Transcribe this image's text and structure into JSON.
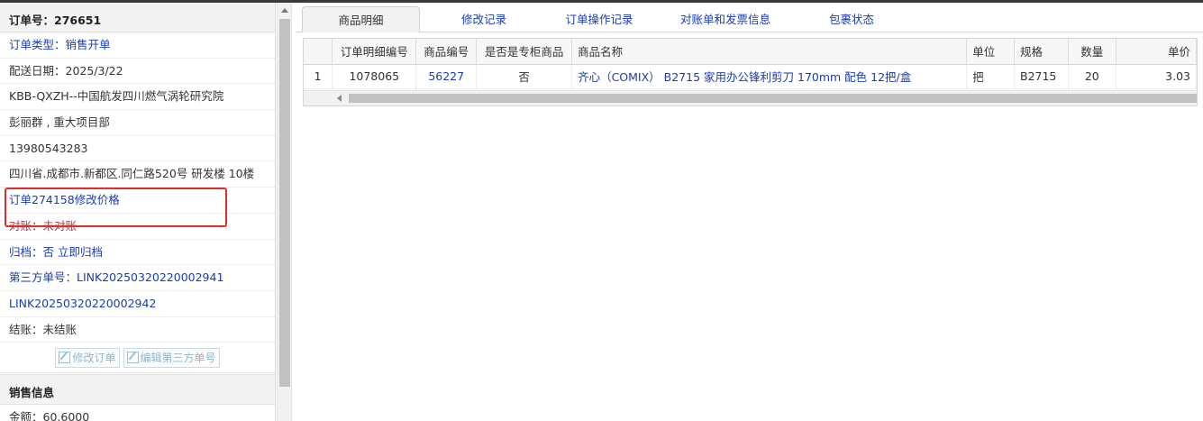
{
  "order": {
    "title": "订单号：276651",
    "type_label": "订单类型：",
    "type_value": "销售开单",
    "delivery_date": "配送日期：2025/3/22",
    "customer": "KBB-QXZH--中国航发四川燃气涡轮研究院",
    "contact": "彭丽群 , 重大项目部",
    "phone": "13980543283",
    "address": "四川省.成都市.新都区.同仁路520号 研发楼 10楼",
    "note": "订单274158修改价格",
    "reconcile": "对账：未对账",
    "archive_label": "归档：",
    "archive_value": "否",
    "archive_action": "立即归档",
    "third_party_label": "第三方单号：",
    "third_party_1": "LINK20250320220002941",
    "third_party_2": "LINK20250320220002942",
    "settlement": "结账：未结账",
    "edit_order_button": "修改订单",
    "edit_third_party_button": "编辑第三方单号"
  },
  "sales": {
    "title": "销售信息",
    "amount": "金额：60.6000"
  },
  "tabs": [
    "商品明细",
    "修改记录",
    "订单操作记录",
    "对账单和发票信息",
    "包裹状态"
  ],
  "active_tab": "商品明细",
  "table": {
    "columns": [
      "订单明细编号",
      "商品编号",
      "是否是专柜商品",
      "商品名称",
      "单位",
      "规格",
      "数量",
      "单价"
    ],
    "rows": [
      {
        "index": "1",
        "detail_id": "1078065",
        "product_id": "56227",
        "counter": "否",
        "name": "齐心（COMIX） B2715 家用办公锋利剪刀 170mm 配色 12把/盒",
        "unit": "把",
        "spec": "B2715",
        "qty": "20",
        "price": "3.03"
      }
    ]
  },
  "colors": {
    "link": "#1a3db0",
    "highlight_box": "#d9302c",
    "reconcile_text": "#b3324d"
  }
}
